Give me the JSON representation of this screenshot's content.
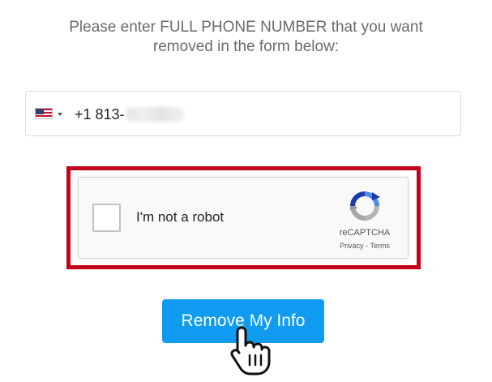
{
  "instructions": {
    "line1": "Please enter FULL PHONE NUMBER that you want",
    "line2": "removed in the form below:"
  },
  "phone": {
    "country_flag_icon": "us-flag-icon",
    "visible_value": "+1 813-",
    "redacted": true
  },
  "recaptcha": {
    "label": "I'm not a robot",
    "brand": "reCAPTCHA",
    "privacy_link": "Privacy",
    "separator": "-",
    "terms_link": "Terms",
    "checked": false
  },
  "remove_button": {
    "label": "Remove My Info"
  },
  "colors": {
    "highlight_border": "#c4001a",
    "button_bg": "#0f9bf0",
    "instruction_text": "#6b6b6b"
  }
}
